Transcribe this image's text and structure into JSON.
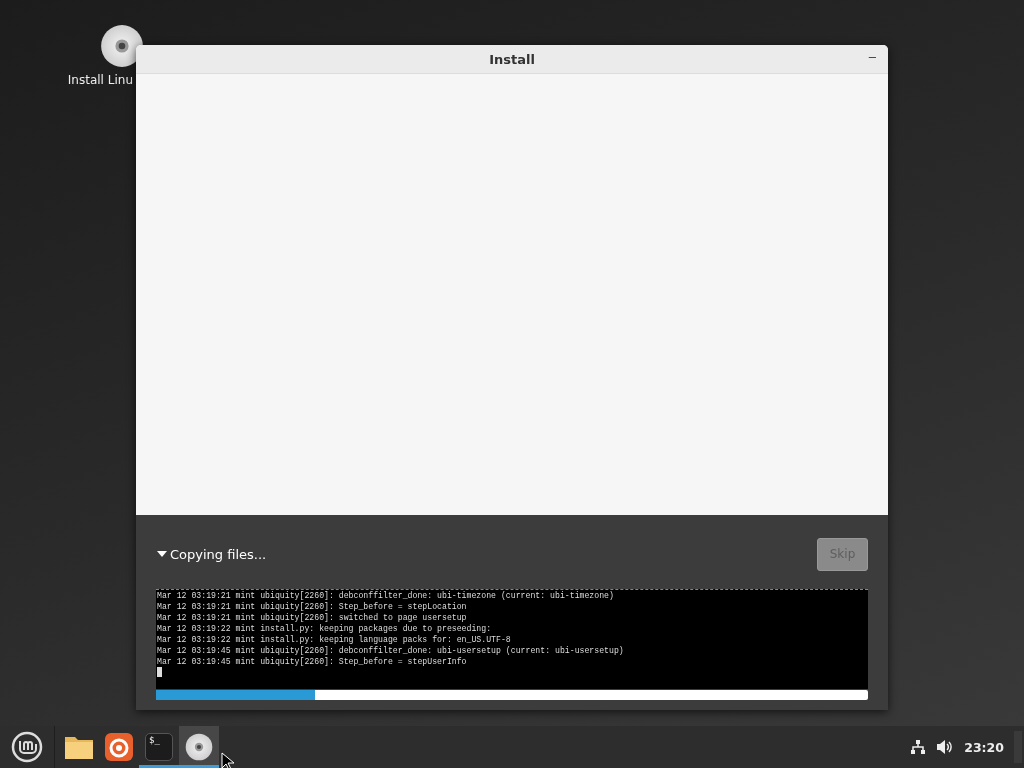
{
  "desktop": {
    "icons": [
      {
        "label": "Install Linu"
      }
    ]
  },
  "window": {
    "title": "Install",
    "minimize": "–",
    "status": {
      "label": "Copying files...",
      "expanded": true
    },
    "skip_button": {
      "label": "Skip",
      "disabled": true
    },
    "log": [
      "Mar 12 03:19:21 mint ubiquity[2260]: debconffilter_done: ubi-timezone (current: ubi-timezone)",
      "Mar 12 03:19:21 mint ubiquity[2260]: Step_before = stepLocation",
      "Mar 12 03:19:21 mint ubiquity[2260]: switched to page usersetup",
      "Mar 12 03:19:22 mint install.py: keeping packages due to preseeding:",
      "Mar 12 03:19:22 mint install.py: keeping language packs for: en_US.UTF-8",
      "Mar 12 03:19:45 mint ubiquity[2260]: debconffilter_done: ubi-usersetup (current: ubi-usersetup)",
      "Mar 12 03:19:45 mint ubiquity[2260]: Step_before = stepUserInfo"
    ],
    "progress": {
      "level": 0.223
    }
  },
  "taskbar": {
    "apps": [
      {
        "kind": "folder",
        "running": false,
        "active": false
      },
      {
        "kind": "browser",
        "running": false,
        "active": false
      },
      {
        "kind": "terminal",
        "label": "$_",
        "running": true,
        "active": false
      },
      {
        "kind": "disc",
        "running": true,
        "active": true
      }
    ],
    "clock": "23:20"
  }
}
